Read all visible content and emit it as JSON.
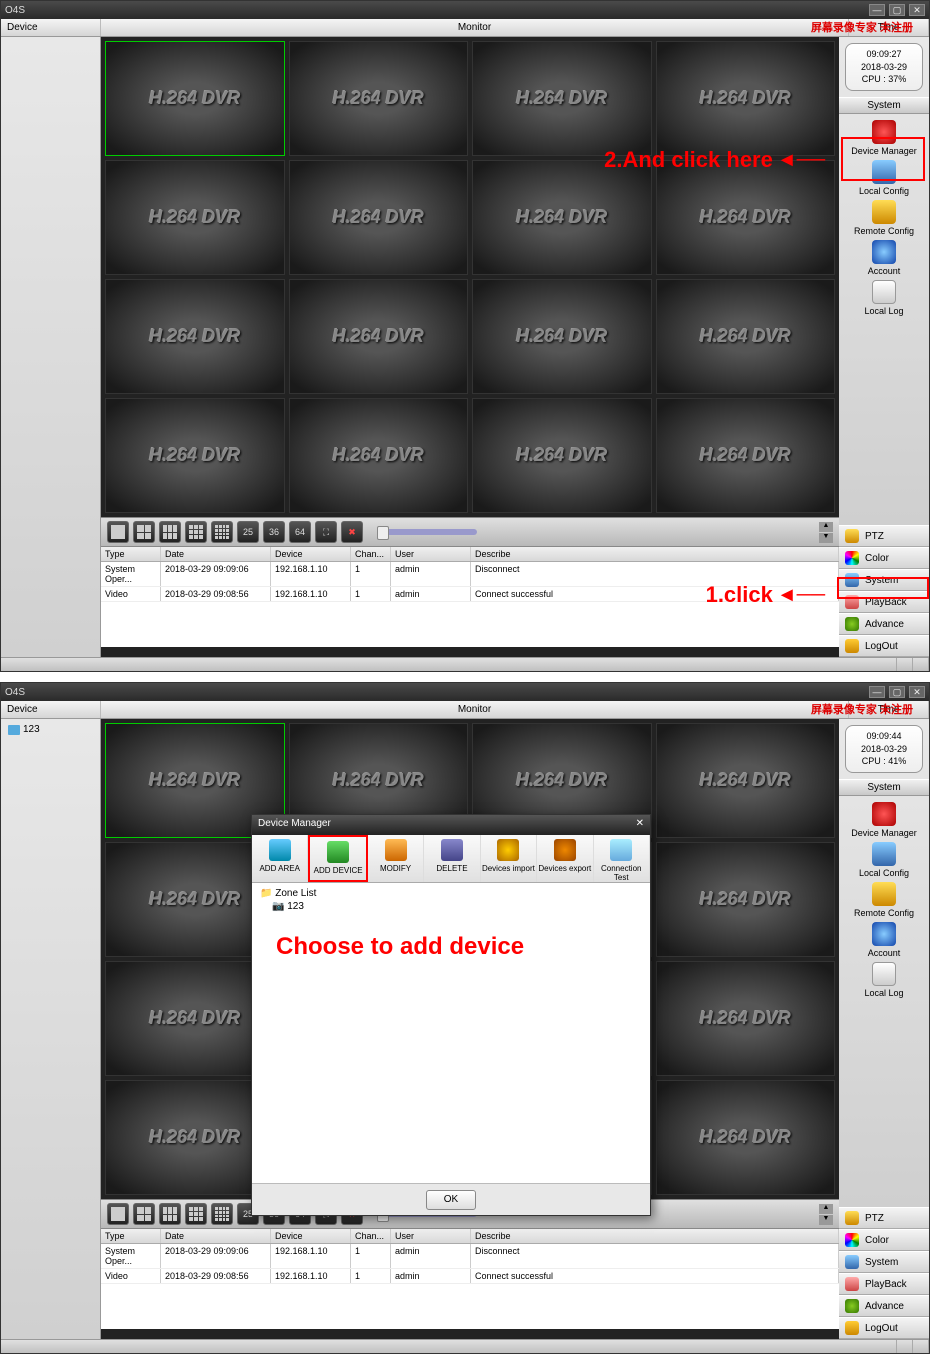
{
  "top": {
    "appTitle": "O4S",
    "watermark": "屏幕录像专家 未注册",
    "camLabel": "H.264 DVR",
    "header": {
      "device": "Device",
      "monitor": "Monitor",
      "time": "Time"
    },
    "info": {
      "time": "09:09:27",
      "date": "2018-03-29",
      "cpu": "CPU : 37%"
    },
    "accordion": {
      "system": "System"
    },
    "sysItems": [
      {
        "label": "Device Manager"
      },
      {
        "label": "Local Config"
      },
      {
        "label": "Remote Config"
      },
      {
        "label": "Account"
      },
      {
        "label": "Local Log"
      }
    ],
    "toolNums": {
      "n25": "25",
      "n36": "36",
      "n64": "64"
    },
    "logHead": {
      "type": "Type",
      "date": "Date",
      "device": "Device",
      "chan": "Chan...",
      "user": "User",
      "desc": "Describe"
    },
    "logRows": [
      {
        "type": "System Oper...",
        "date": "2018-03-29 09:09:06",
        "device": "192.168.1.10",
        "chan": "1",
        "user": "admin",
        "desc": "Disconnect"
      },
      {
        "type": "Video",
        "date": "2018-03-29 09:08:56",
        "device": "192.168.1.10",
        "chan": "1",
        "user": "admin",
        "desc": "Connect successful"
      }
    ],
    "sideBtns": [
      {
        "label": "PTZ",
        "ic": "ic-yellow"
      },
      {
        "label": "Color",
        "ic": "ic-color"
      },
      {
        "label": "System",
        "ic": "ic-blue"
      },
      {
        "label": "PlayBack",
        "ic": "ic-film"
      },
      {
        "label": "Advance",
        "ic": "ic-down"
      },
      {
        "label": "LogOut",
        "ic": "ic-key"
      }
    ],
    "ann1": "1.click",
    "ann2": "2.And click here"
  },
  "bottom": {
    "appTitle": "O4S",
    "watermark": "屏幕录像专家 未注册",
    "camLabel": "H.264 DVR",
    "header": {
      "device": "Device",
      "monitor": "Monitor",
      "time": "Time"
    },
    "treeItem": "123",
    "info": {
      "time": "09:09:44",
      "date": "2018-03-29",
      "cpu": "CPU : 41%"
    },
    "accordion": {
      "system": "System"
    },
    "sysItems": [
      {
        "label": "Device Manager"
      },
      {
        "label": "Local Config"
      },
      {
        "label": "Remote Config"
      },
      {
        "label": "Account"
      },
      {
        "label": "Local Log"
      }
    ],
    "toolNums": {
      "n25": "25",
      "n36": "36",
      "n64": "64"
    },
    "logHead": {
      "type": "Type",
      "date": "Date",
      "device": "Device",
      "chan": "Chan...",
      "user": "User",
      "desc": "Describe"
    },
    "logRows": [
      {
        "type": "System Oper...",
        "date": "2018-03-29 09:09:06",
        "device": "192.168.1.10",
        "chan": "1",
        "user": "admin",
        "desc": "Disconnect"
      },
      {
        "type": "Video",
        "date": "2018-03-29 09:08:56",
        "device": "192.168.1.10",
        "chan": "1",
        "user": "admin",
        "desc": "Connect successful"
      }
    ],
    "sideBtns": [
      {
        "label": "PTZ",
        "ic": "ic-yellow"
      },
      {
        "label": "Color",
        "ic": "ic-color"
      },
      {
        "label": "System",
        "ic": "ic-blue"
      },
      {
        "label": "PlayBack",
        "ic": "ic-film"
      },
      {
        "label": "Advance",
        "ic": "ic-down"
      },
      {
        "label": "LogOut",
        "ic": "ic-key"
      }
    ],
    "dialog": {
      "title": "Device Manager",
      "tools": [
        {
          "label": "ADD AREA",
          "ic": "dti-area"
        },
        {
          "label": "ADD DEVICE",
          "ic": "dti-add"
        },
        {
          "label": "MODIFY",
          "ic": "dti-mod"
        },
        {
          "label": "DELETE",
          "ic": "dti-del"
        },
        {
          "label": "Devices import",
          "ic": "dti-imp"
        },
        {
          "label": "Devices export",
          "ic": "dti-exp"
        },
        {
          "label": "Connection Test",
          "ic": "dti-test"
        }
      ],
      "zoneList": "Zone List",
      "zoneChild": "123",
      "ok": "OK"
    },
    "ann": "Choose to add device"
  }
}
